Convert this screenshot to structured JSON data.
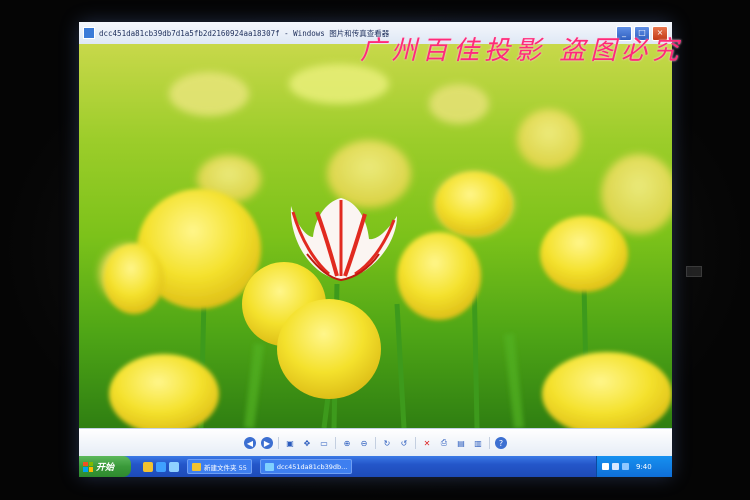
{
  "window": {
    "title": "dcc451da81cb39db7d1a5fb2d2160924aa18307f - Windows 图片和传真查看器",
    "buttons": {
      "minimize": "_",
      "maximize": "□",
      "close": "×"
    }
  },
  "watermark": "广州百佳投影 盗图必究",
  "viewer_toolbar": {
    "icons": [
      "previous-icon",
      "next-icon",
      "best-fit-icon",
      "actual-size-icon",
      "slideshow-icon",
      "zoom-in-icon",
      "zoom-out-icon",
      "rotate-right-icon",
      "rotate-left-icon",
      "delete-icon",
      "print-icon",
      "save-icon",
      "open-icon",
      "help-icon"
    ]
  },
  "taskbar": {
    "start_label": "开始",
    "tasks": [
      {
        "label": "新建文件夹 55"
      },
      {
        "label": "dcc451da81cb39db..."
      }
    ],
    "clock": "9:40"
  },
  "colors": {
    "watermark": "#ff2a7a",
    "taskbar": "#2456c9",
    "start_button": "#3a9a3a"
  }
}
